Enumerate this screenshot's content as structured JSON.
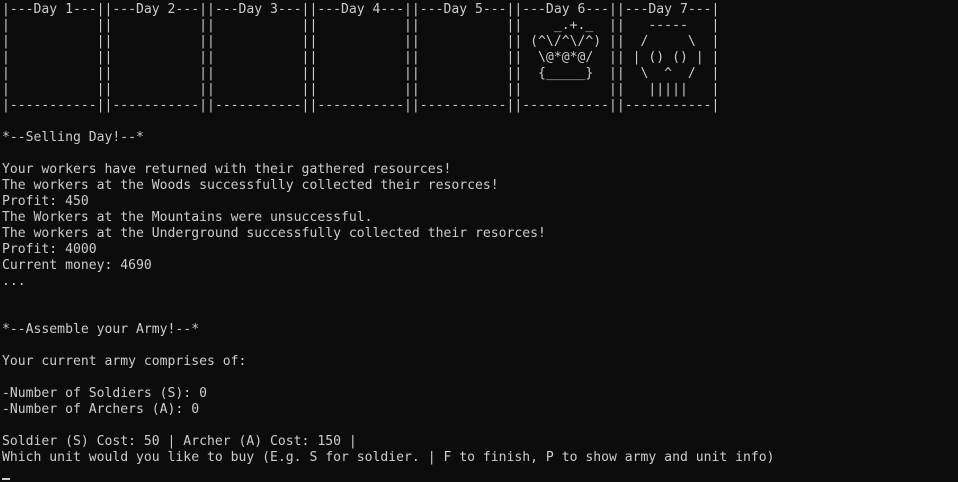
{
  "calendar": {
    "rows": [
      "|---Day 1---||---Day 2---||---Day 3---||---Day 4---||---Day 5---||---Day 6---||---Day 7---|",
      "|           ||           ||           ||           ||           ||    _.+._  ||   -----   |",
      "|           ||           ||           ||           ||           || (^\\/^\\/^) ||  /     \\  |",
      "|           ||           ||           ||           ||           ||  \\@*@*@/  || | () () | |",
      "|           ||           ||           ||           ||           ||  {_____}  ||  \\  ^  /  |",
      "|           ||           ||           ||           ||           ||           ||   |||||   |",
      "|-----------||-----------||-----------||-----------||-----------||-----------||-----------|"
    ]
  },
  "selling": {
    "header": "*--Selling Day!--*",
    "returned": "Your workers have returned with their gathered resources!",
    "woods": "The workers at the Woods successfully collected their resorces!",
    "woods_profit": "Profit: 450",
    "mountains": "The Workers at the Mountains were unsuccessful.",
    "underground": "The workers at the Underground successfully collected their resorces!",
    "underground_profit": "Profit: 4000",
    "current_money": "Current money: 4690",
    "ellipsis": "..."
  },
  "army": {
    "header": "*--Assemble your Army!--*",
    "comprises": "Your current army comprises of:",
    "soldiers": "-Number of Soldiers (S): 0",
    "archers": "-Number of Archers (A): 0",
    "costs": "Soldier (S) Cost: 50 | Archer (A) Cost: 150 |",
    "prompt": "Which unit would you like to buy (E.g. S for soldier. | F to finish, P to show army and unit info)"
  },
  "colors": {
    "background": "#0c0c0c",
    "foreground": "#cccccc"
  }
}
